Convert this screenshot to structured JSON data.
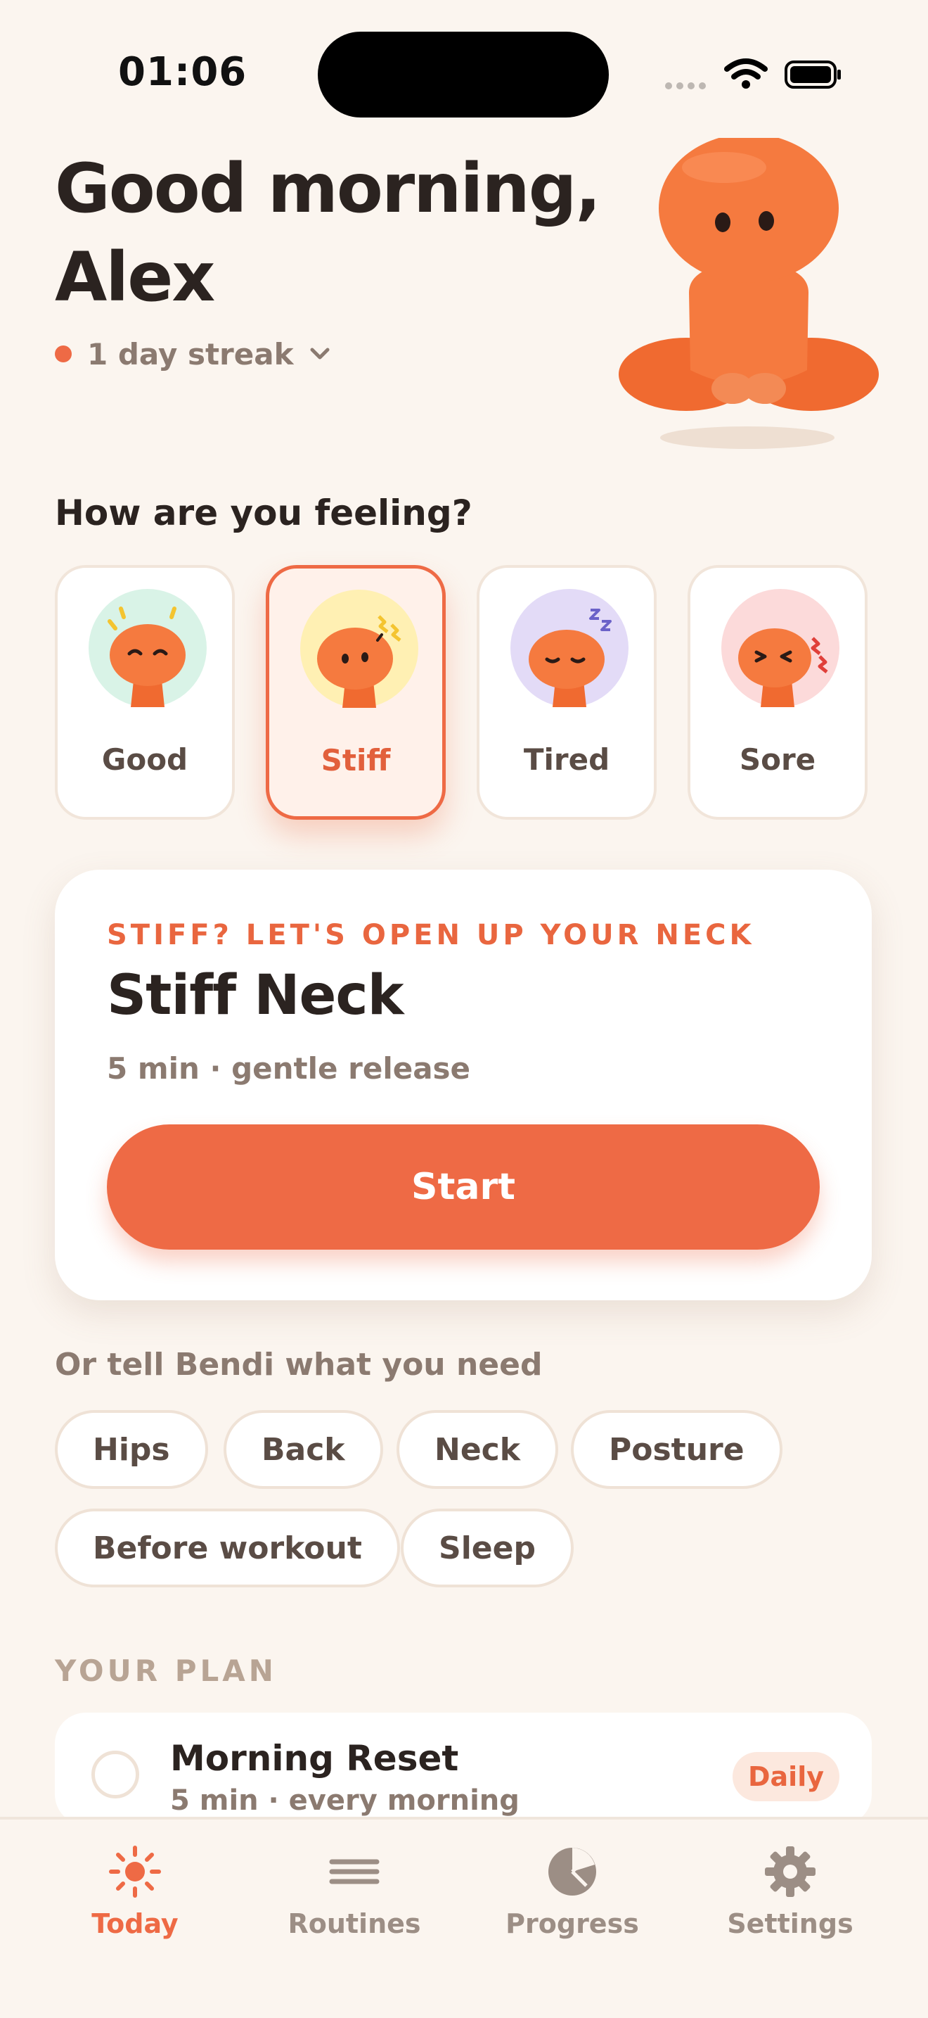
{
  "status_bar": {
    "time": "01:06"
  },
  "header": {
    "greeting_line1": "Good morning,",
    "greeting_line2": "Alex",
    "streak_label": "1 day streak"
  },
  "feeling": {
    "title": "How are you feeling?",
    "selected": "Stiff",
    "moods": [
      {
        "label": "Good",
        "bg_color": "#D9F3E7"
      },
      {
        "label": "Stiff",
        "bg_color": "#FFF0B3"
      },
      {
        "label": "Tired",
        "bg_color": "#E3DBF7"
      },
      {
        "label": "Sore",
        "bg_color": "#FCDADA"
      }
    ]
  },
  "recommendation": {
    "eyebrow": "STIFF? LET'S OPEN UP YOUR NECK",
    "title": "Stiff Neck",
    "subtitle": "5 min · gentle release",
    "start_label": "Start"
  },
  "needs": {
    "title": "Or tell Bendi what you need",
    "chips": [
      "Hips",
      "Back",
      "Neck",
      "Posture",
      "Before workout",
      "Sleep"
    ]
  },
  "plan": {
    "title": "YOUR PLAN",
    "items": [
      {
        "name": "Morning Reset",
        "meta": "5 min · every morning",
        "badge": "Daily"
      }
    ]
  },
  "tab_bar": {
    "active": "Today",
    "tabs": [
      {
        "label": "Today",
        "icon": "sun-icon"
      },
      {
        "label": "Routines",
        "icon": "menu-lines-icon"
      },
      {
        "label": "Progress",
        "icon": "pie-chart-icon"
      },
      {
        "label": "Settings",
        "icon": "gear-icon"
      }
    ]
  },
  "colors": {
    "accent": "#EE6A45",
    "background": "#FBF5EF",
    "mascot": "#F26A32",
    "text_primary": "#2B2320",
    "text_secondary": "#8B7A70"
  }
}
